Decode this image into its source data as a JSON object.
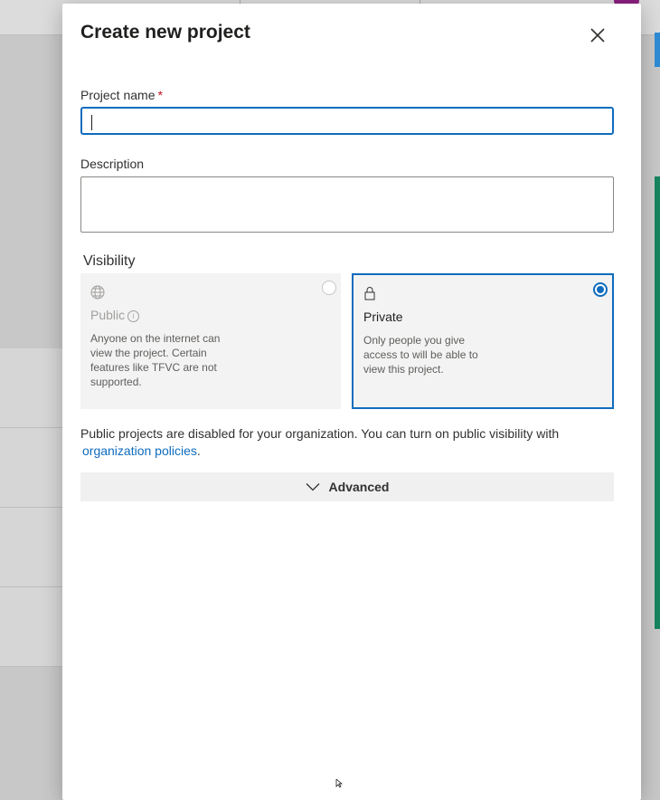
{
  "dialog": {
    "title": "Create new project",
    "project_name_label": "Project name",
    "required_marker": "*",
    "project_name_value": "",
    "description_label": "Description",
    "description_value": "",
    "visibility_label": "Visibility",
    "public": {
      "title": "Public",
      "description": "Anyone on the internet can view the project. Certain features like TFVC are not supported.",
      "selected": false,
      "disabled": true
    },
    "private": {
      "title": "Private",
      "description": "Only people you give access to will be able to view this project.",
      "selected": true
    },
    "note_text": "Public projects are disabled for your organization. You can turn on public visibility with",
    "note_link": "organization policies",
    "note_end": ".",
    "advanced_label": "Advanced"
  },
  "colors": {
    "accent": "#0f6cbd",
    "required": "#c50f1f"
  },
  "icons": {
    "close": "close-icon",
    "public": "globe-icon",
    "private": "lock-icon",
    "info": "info-icon",
    "advanced": "chevron-down-icon"
  }
}
